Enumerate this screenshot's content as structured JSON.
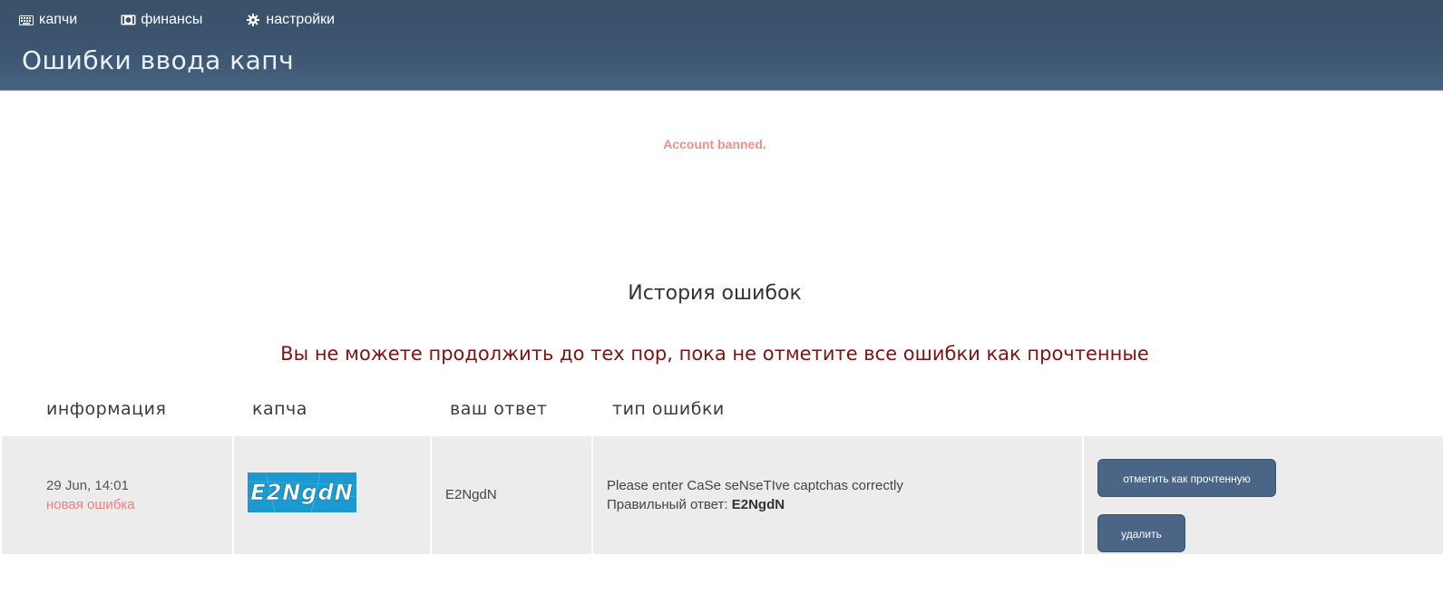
{
  "nav": {
    "items": [
      {
        "label": "капчи",
        "icon": "keyboard-icon"
      },
      {
        "label": "финансы",
        "icon": "money-icon"
      },
      {
        "label": "настройки",
        "icon": "gear-icon"
      }
    ]
  },
  "page": {
    "title": "Ошибки ввода капч",
    "banned_message": "Account banned."
  },
  "history": {
    "title": "История ошибок",
    "warning": "Вы не можете продолжить до тех пор, пока не отметите все ошибки как прочтенные",
    "columns": [
      "информация",
      "капча",
      "ваш ответ",
      "тип ошибки"
    ],
    "rows": [
      {
        "date": "29 Jun, 14:01",
        "status": "новая ошибка",
        "captcha_text": "E2NgdN",
        "answer": "E2NgdN",
        "error_message": "Please enter CaSe seNseTIve captchas correctly",
        "correct_label": "Правильный ответ:",
        "correct_value": "E2NgdN",
        "mark_read_label": "отметить как прочтенную",
        "delete_label": "удалить"
      }
    ]
  },
  "colors": {
    "header": "#3c5570",
    "button": "#4a6585",
    "banned": "#ef8f8a",
    "warning": "#7a1414",
    "new_error": "#e9827d",
    "captcha_bg": "#1a9ad1"
  }
}
